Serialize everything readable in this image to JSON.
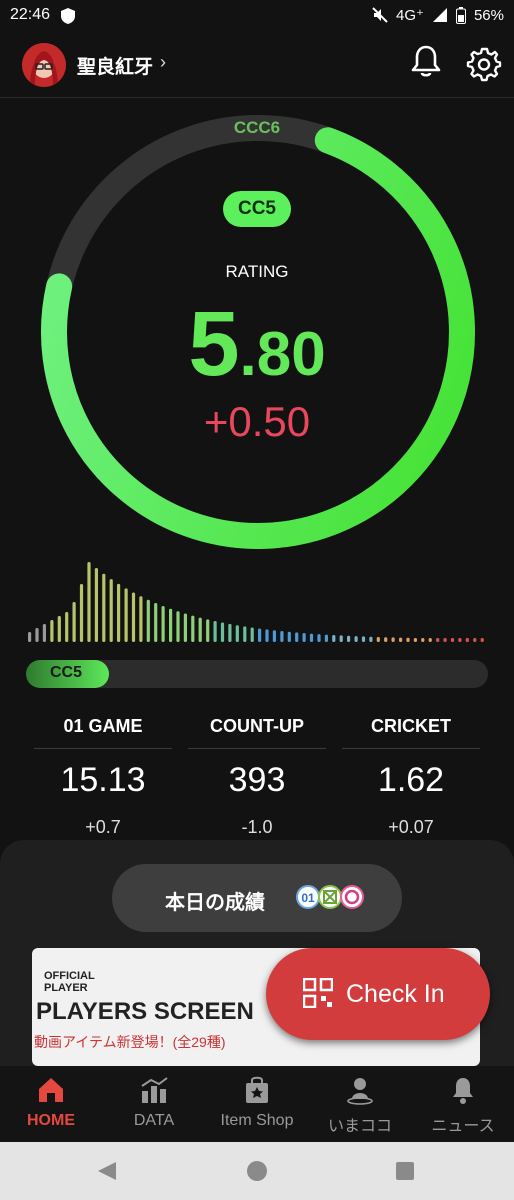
{
  "status_bar": {
    "time": "22:46",
    "network": "4G⁺",
    "battery": "56%"
  },
  "header": {
    "username": "聖良紅牙",
    "chevron": "›"
  },
  "rating": {
    "top_class": "CCC6",
    "current_class": "CC5",
    "label": "RATING",
    "value_integer": "5",
    "value_decimal": ".80",
    "delta": "+0.50",
    "ring_progress": 0.73
  },
  "progress": {
    "label": "CC5",
    "fraction": 0.18
  },
  "stats": [
    {
      "name": "01 GAME",
      "value": "15.13",
      "delta": "+0.7"
    },
    {
      "name": "COUNT-UP",
      "value": "393",
      "delta": "-1.0"
    },
    {
      "name": "CRICKET",
      "value": "1.62",
      "delta": "+0.07"
    }
  ],
  "today": {
    "label": "本日の成績",
    "mode_icons": [
      "01-icon",
      "cricket-icon",
      "countup-icon"
    ],
    "mode_text": "01"
  },
  "banner": {
    "official_line1": "OFFICIAL",
    "official_line2": "PLAYER",
    "title": "PLAYERS SCREEN",
    "subtitle": "動画アイテム新登場！(全29種)"
  },
  "check_in": {
    "label": "Check In"
  },
  "tabs": [
    {
      "label": "HOME",
      "icon": "home-icon",
      "active": true
    },
    {
      "label": "DATA",
      "icon": "chart-icon",
      "active": false
    },
    {
      "label": "Item Shop",
      "icon": "shop-icon",
      "active": false
    },
    {
      "label": "いまココ",
      "icon": "location-icon",
      "active": false
    },
    {
      "label": "ニュース",
      "icon": "bell-icon",
      "active": false
    }
  ],
  "colors": {
    "accent_green": "#63e85a",
    "delta_red": "#e8475d",
    "checkin_red": "#d23c3c",
    "active_tab": "#e5483f"
  }
}
